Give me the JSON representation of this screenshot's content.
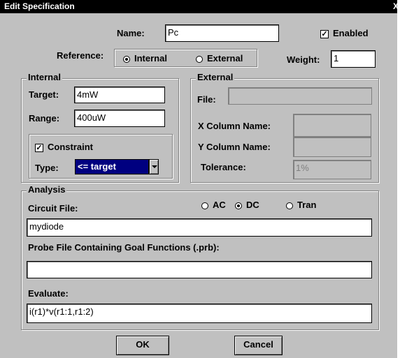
{
  "window": {
    "title": "Edit Specification",
    "close_glyph": "X"
  },
  "header": {
    "name_label": "Name:",
    "name_value": "Pc",
    "enabled_label": "Enabled",
    "enabled_checked": true,
    "reference_label": "Reference:",
    "reference_options": [
      "Internal",
      "External"
    ],
    "reference_selected": "Internal",
    "weight_label": "Weight:",
    "weight_value": "1"
  },
  "internal": {
    "title": "Internal",
    "target_label": "Target:",
    "target_value": "4mW",
    "range_label": "Range:",
    "range_value": "400uW",
    "constraint_label": "Constraint",
    "constraint_checked": true,
    "type_label": "Type:",
    "type_value": "<= target"
  },
  "external": {
    "title": "External",
    "file_label": "File:",
    "file_value": "",
    "x_column_label": "X Column Name:",
    "x_column_value": "",
    "y_column_label": "Y Column Name:",
    "y_column_value": "",
    "tolerance_label": "Tolerance:",
    "tolerance_value": "1%"
  },
  "analysis": {
    "title": "Analysis",
    "modes": [
      "AC",
      "DC",
      "Tran"
    ],
    "mode_selected": "DC",
    "circuit_file_label": "Circuit File:",
    "circuit_file_value": "mydiode",
    "probe_file_label": "Probe File Containing Goal Functions (.prb):",
    "probe_file_value": "",
    "evaluate_label": "Evaluate:",
    "evaluate_value": "i(r1)*v(r1:1,r1:2)"
  },
  "buttons": {
    "ok_label": "OK",
    "cancel_label": "Cancel"
  }
}
